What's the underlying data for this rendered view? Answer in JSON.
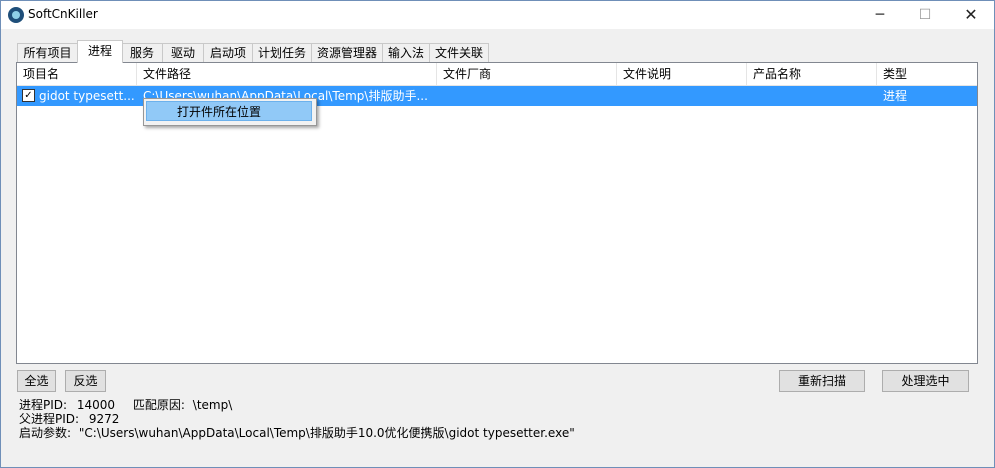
{
  "window": {
    "title": "SoftCnKiller",
    "min_glyph": "─",
    "max_glyph": "☐",
    "close_glyph": "✕"
  },
  "tabs": [
    "所有项目",
    "进程",
    "服务",
    "驱动",
    "启动项",
    "计划任务",
    "资源管理器",
    "输入法",
    "文件关联"
  ],
  "active_tab": "进程",
  "table": {
    "columns": [
      "项目名",
      "文件路径",
      "文件厂商",
      "文件说明",
      "产品名称",
      "类型"
    ],
    "rows": [
      {
        "checked": true,
        "name": "gidot typesett...",
        "path": "C:\\Users\\wuhan\\AppData\\Local\\Temp\\排版助手...",
        "vendor": "",
        "description": "",
        "product": "",
        "type": "进程"
      }
    ]
  },
  "context_menu": {
    "items": [
      "打开件所在位置"
    ]
  },
  "buttons": {
    "select_all": "全选",
    "invert": "反选",
    "rescan": "重新扫描",
    "process_selected": "处理选中"
  },
  "details": {
    "pid_label": "进程PID:",
    "pid": "14000",
    "match_label": "匹配原因:",
    "match": "\\temp\\",
    "ppid_label": "父进程PID:",
    "ppid": "9272",
    "args_label": "启动参数:",
    "args": "\"C:\\Users\\wuhan\\AppData\\Local\\Temp\\排版助手10.0优化便携版\\gidot typesetter.exe\""
  },
  "colors": {
    "selection": "#3399ff",
    "menu_highlight": "#91c9f7"
  }
}
